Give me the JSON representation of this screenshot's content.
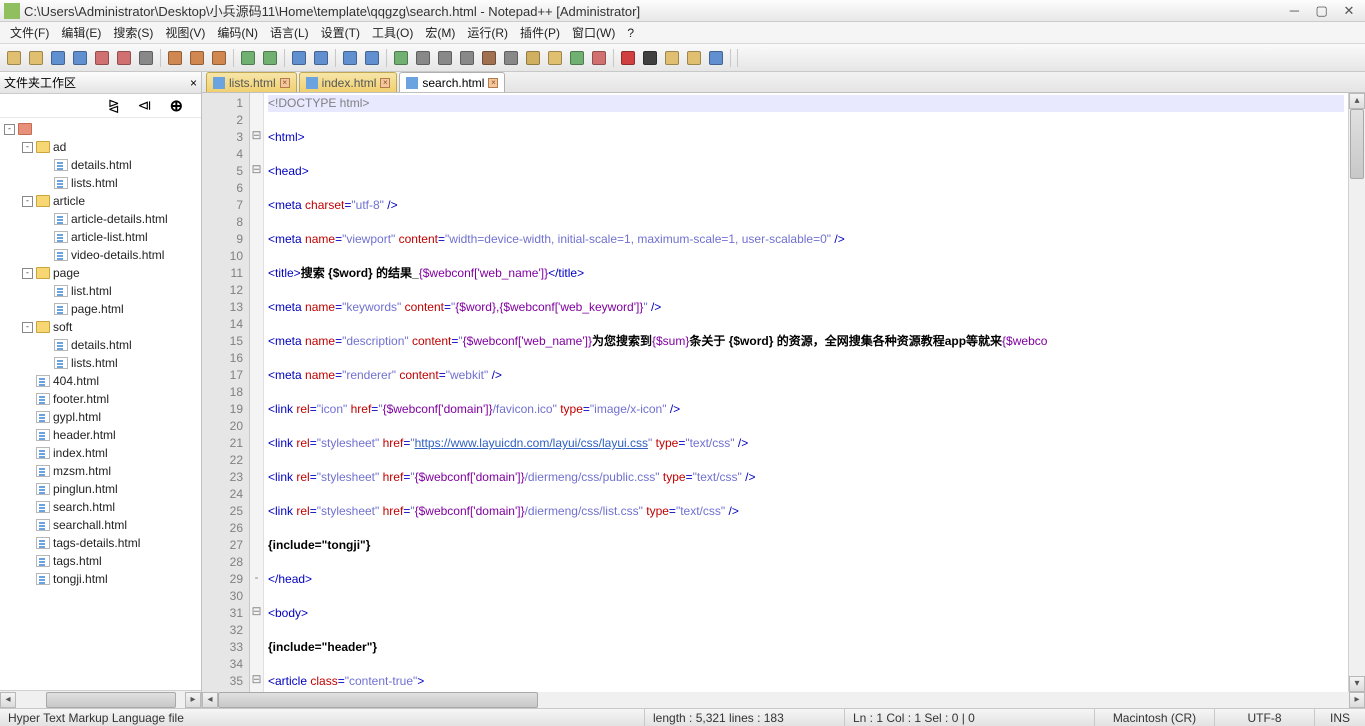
{
  "title": "C:\\Users\\Administrator\\Desktop\\小兵源码11\\Home\\template\\qqgzg\\search.html - Notepad++ [Administrator]",
  "menus": [
    "文件(F)",
    "编辑(E)",
    "搜索(S)",
    "视图(V)",
    "编码(N)",
    "语言(L)",
    "设置(T)",
    "工具(O)",
    "宏(M)",
    "运行(R)",
    "插件(P)",
    "窗口(W)",
    "?"
  ],
  "sidebar_title": "文件夹工作区",
  "tree": [
    {
      "d": 0,
      "t": "-",
      "i": "folder-r",
      "l": ""
    },
    {
      "d": 1,
      "t": "-",
      "i": "folder-y",
      "l": "ad"
    },
    {
      "d": 2,
      "t": "",
      "i": "file-i",
      "l": "details.html"
    },
    {
      "d": 2,
      "t": "",
      "i": "file-i",
      "l": "lists.html"
    },
    {
      "d": 1,
      "t": "-",
      "i": "folder-y",
      "l": "article"
    },
    {
      "d": 2,
      "t": "",
      "i": "file-i",
      "l": "article-details.html"
    },
    {
      "d": 2,
      "t": "",
      "i": "file-i",
      "l": "article-list.html"
    },
    {
      "d": 2,
      "t": "",
      "i": "file-i",
      "l": "video-details.html"
    },
    {
      "d": 1,
      "t": "-",
      "i": "folder-y",
      "l": "page"
    },
    {
      "d": 2,
      "t": "",
      "i": "file-i",
      "l": "list.html"
    },
    {
      "d": 2,
      "t": "",
      "i": "file-i",
      "l": "page.html"
    },
    {
      "d": 1,
      "t": "-",
      "i": "folder-y",
      "l": "soft"
    },
    {
      "d": 2,
      "t": "",
      "i": "file-i",
      "l": "details.html"
    },
    {
      "d": 2,
      "t": "",
      "i": "file-i",
      "l": "lists.html"
    },
    {
      "d": 1,
      "t": "",
      "i": "file-i",
      "l": "404.html"
    },
    {
      "d": 1,
      "t": "",
      "i": "file-i",
      "l": "footer.html"
    },
    {
      "d": 1,
      "t": "",
      "i": "file-i",
      "l": "gypl.html"
    },
    {
      "d": 1,
      "t": "",
      "i": "file-i",
      "l": "header.html"
    },
    {
      "d": 1,
      "t": "",
      "i": "file-i",
      "l": "index.html"
    },
    {
      "d": 1,
      "t": "",
      "i": "file-i",
      "l": "mzsm.html"
    },
    {
      "d": 1,
      "t": "",
      "i": "file-i",
      "l": "pinglun.html"
    },
    {
      "d": 1,
      "t": "",
      "i": "file-i",
      "l": "search.html"
    },
    {
      "d": 1,
      "t": "",
      "i": "file-i",
      "l": "searchall.html"
    },
    {
      "d": 1,
      "t": "",
      "i": "file-i",
      "l": "tags-details.html"
    },
    {
      "d": 1,
      "t": "",
      "i": "file-i",
      "l": "tags.html"
    },
    {
      "d": 1,
      "t": "",
      "i": "file-i",
      "l": "tongji.html"
    }
  ],
  "tabs": [
    {
      "label": "lists.html",
      "active": false
    },
    {
      "label": "index.html",
      "active": false
    },
    {
      "label": "search.html",
      "active": true
    }
  ],
  "code_lines": [
    {
      "n": 1,
      "f": "",
      "hl": true,
      "html": "<span class='t-comment'>&lt;!DOCTYPE html&gt;</span>"
    },
    {
      "n": 2,
      "f": "",
      "html": ""
    },
    {
      "n": 3,
      "f": "⊟",
      "html": "<span class='t-tag'>&lt;html&gt;</span>"
    },
    {
      "n": 4,
      "f": "",
      "html": ""
    },
    {
      "n": 5,
      "f": "⊟",
      "html": "<span class='t-tag'>&lt;head&gt;</span>"
    },
    {
      "n": 6,
      "f": "",
      "html": ""
    },
    {
      "n": 7,
      "f": "",
      "html": "<span class='t-tag'>&lt;meta</span> <span class='t-attr'>charset</span><span class='t-tag'>=</span><span class='t-str'>\"utf-8\"</span> <span class='t-tag'>/&gt;</span>"
    },
    {
      "n": 8,
      "f": "",
      "html": ""
    },
    {
      "n": 9,
      "f": "",
      "html": "<span class='t-tag'>&lt;meta</span> <span class='t-attr'>name</span><span class='t-tag'>=</span><span class='t-str'>\"viewport\"</span> <span class='t-attr'>content</span><span class='t-tag'>=</span><span class='t-str'>\"width=device-width, initial-scale=1, maximum-scale=1, user-scalable=0\"</span> <span class='t-tag'>/&gt;</span>"
    },
    {
      "n": 10,
      "f": "",
      "html": ""
    },
    {
      "n": 11,
      "f": "",
      "html": "<span class='t-tag'>&lt;title&gt;</span><span class='t-text'>搜索 {$word} 的结果_</span><span class='t-purple'>{$webconf['web_name']}</span><span class='t-tag'>&lt;/title&gt;</span>"
    },
    {
      "n": 12,
      "f": "",
      "html": ""
    },
    {
      "n": 13,
      "f": "",
      "html": "<span class='t-tag'>&lt;meta</span> <span class='t-attr'>name</span><span class='t-tag'>=</span><span class='t-str'>\"keywords\"</span> <span class='t-attr'>content</span><span class='t-tag'>=</span><span class='t-str'>\"</span><span class='t-purple'>{$word},{$webconf['web_keyword']}</span><span class='t-str'>\"</span> <span class='t-tag'>/&gt;</span>"
    },
    {
      "n": 14,
      "f": "",
      "html": ""
    },
    {
      "n": 15,
      "f": "",
      "html": "<span class='t-tag'>&lt;meta</span> <span class='t-attr'>name</span><span class='t-tag'>=</span><span class='t-str'>\"description\"</span> <span class='t-attr'>content</span><span class='t-tag'>=</span><span class='t-str'>\"</span><span class='t-purple'>{$webconf['web_name']}</span><span class='t-text'>为您搜索到</span><span class='t-purple'>{$sum}</span><span class='t-text'>条关于 {$word} 的资源，全网搜集各种资源教程app等就来</span><span class='t-purple'>{$webco</span>"
    },
    {
      "n": 16,
      "f": "",
      "html": ""
    },
    {
      "n": 17,
      "f": "",
      "html": "<span class='t-tag'>&lt;meta</span> <span class='t-attr'>name</span><span class='t-tag'>=</span><span class='t-str'>\"renderer\"</span> <span class='t-attr'>content</span><span class='t-tag'>=</span><span class='t-str'>\"webkit\"</span> <span class='t-tag'>/&gt;</span>"
    },
    {
      "n": 18,
      "f": "",
      "html": ""
    },
    {
      "n": 19,
      "f": "",
      "html": "<span class='t-tag'>&lt;link</span> <span class='t-attr'>rel</span><span class='t-tag'>=</span><span class='t-str'>\"icon\"</span> <span class='t-attr'>href</span><span class='t-tag'>=</span><span class='t-str'>\"</span><span class='t-purple'>{$webconf['domain']}</span><span class='t-str'>/favicon.ico\"</span> <span class='t-attr'>type</span><span class='t-tag'>=</span><span class='t-str'>\"image/x-icon\"</span> <span class='t-tag'>/&gt;</span>"
    },
    {
      "n": 20,
      "f": "",
      "html": ""
    },
    {
      "n": 21,
      "f": "",
      "html": "<span class='t-tag'>&lt;link</span> <span class='t-attr'>rel</span><span class='t-tag'>=</span><span class='t-str'>\"stylesheet\"</span> <span class='t-attr'>href</span><span class='t-tag'>=</span><span class='t-str'>\"</span><span class='t-url'>https://www.layuicdn.com/layui/css/layui.css</span><span class='t-str'>\"</span> <span class='t-attr'>type</span><span class='t-tag'>=</span><span class='t-str'>\"text/css\"</span> <span class='t-tag'>/&gt;</span>"
    },
    {
      "n": 22,
      "f": "",
      "html": ""
    },
    {
      "n": 23,
      "f": "",
      "html": "<span class='t-tag'>&lt;link</span> <span class='t-attr'>rel</span><span class='t-tag'>=</span><span class='t-str'>\"stylesheet\"</span> <span class='t-attr'>href</span><span class='t-tag'>=</span><span class='t-str'>\"</span><span class='t-purple'>{$webconf['domain']}</span><span class='t-str'>/diermeng/css/public.css\"</span> <span class='t-attr'>type</span><span class='t-tag'>=</span><span class='t-str'>\"text/css\"</span> <span class='t-tag'>/&gt;</span>"
    },
    {
      "n": 24,
      "f": "",
      "html": ""
    },
    {
      "n": 25,
      "f": "",
      "html": "<span class='t-tag'>&lt;link</span> <span class='t-attr'>rel</span><span class='t-tag'>=</span><span class='t-str'>\"stylesheet\"</span> <span class='t-attr'>href</span><span class='t-tag'>=</span><span class='t-str'>\"</span><span class='t-purple'>{$webconf['domain']}</span><span class='t-str'>/diermeng/css/list.css\"</span> <span class='t-attr'>type</span><span class='t-tag'>=</span><span class='t-str'>\"text/css\"</span> <span class='t-tag'>/&gt;</span>"
    },
    {
      "n": 26,
      "f": "",
      "html": ""
    },
    {
      "n": 27,
      "f": "",
      "html": "<span class='t-text'>{include=\"tongji\"}</span>"
    },
    {
      "n": 28,
      "f": "",
      "html": ""
    },
    {
      "n": 29,
      "f": "-",
      "html": "<span class='t-tag'>&lt;/head&gt;</span>"
    },
    {
      "n": 30,
      "f": "",
      "html": ""
    },
    {
      "n": 31,
      "f": "⊟",
      "html": "<span class='t-tag'>&lt;body&gt;</span>"
    },
    {
      "n": 32,
      "f": "",
      "html": ""
    },
    {
      "n": 33,
      "f": "",
      "html": "<span class='t-text'>{include=\"header\"}</span>"
    },
    {
      "n": 34,
      "f": "",
      "html": ""
    },
    {
      "n": 35,
      "f": "⊟",
      "html": "<span class='t-tag'>&lt;article</span> <span class='t-attr'>class</span><span class='t-tag'>=</span><span class='t-str'>\"content-true\"</span><span class='t-tag'>&gt;</span>"
    }
  ],
  "status": {
    "filetype": "Hyper Text Markup Language file",
    "length": "length : 5,321    lines : 183",
    "pos": "Ln : 1    Col : 1    Sel : 0 | 0",
    "eol": "Macintosh (CR)",
    "enc": "UTF-8",
    "ins": "INS"
  },
  "toolbar_icons": [
    "new",
    "open",
    "save",
    "save-all",
    "close",
    "close-all",
    "print",
    "",
    "cut",
    "copy",
    "paste",
    "",
    "undo",
    "redo",
    "",
    "find",
    "replace",
    "",
    "zoom-in",
    "zoom-out",
    "",
    "sync",
    "wrap",
    "monitor",
    "lang",
    "guide",
    "indent",
    "func",
    "folder",
    "comment",
    "hide",
    "",
    "rec",
    "stop",
    "play",
    "play-m",
    "save-m",
    "",
    ""
  ]
}
